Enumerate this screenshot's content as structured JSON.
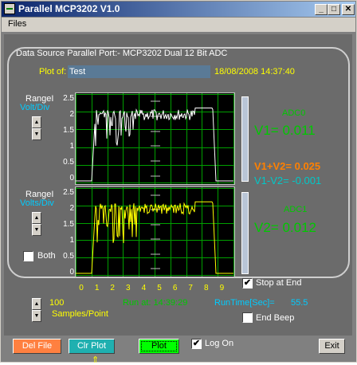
{
  "window": {
    "title": "Parallel MCP3202 V1.0",
    "minimize": "_",
    "maximize": "□",
    "close": "✕"
  },
  "menu": {
    "files": "Files"
  },
  "header": {
    "data_source": "Data Source Parallel Port:-   MCP3202 Dual 12 Bit ADC",
    "plot_of_label": "Plot of:",
    "plot_of_value": "Test",
    "datetime": "18/08/2008 14:37:40"
  },
  "range1": {
    "label": "RangeI",
    "sub": "Volt/Div"
  },
  "range2": {
    "label": "RangeI",
    "sub": "Volts/Div"
  },
  "both_label": "Both",
  "y_ticks": [
    "2.5",
    "2",
    "1.5",
    "1",
    "0.5",
    "0"
  ],
  "x_ticks": [
    "0",
    "1",
    "2",
    "3",
    "4",
    "5",
    "6",
    "7",
    "8",
    "9"
  ],
  "adc0": {
    "label": "ADC0",
    "value": "V1= 0.011"
  },
  "adc1": {
    "label": "ADC1",
    "value": "V2= 0.012"
  },
  "sum": "V1+V2= 0.025",
  "diff": "V1-V2=  -0.001",
  "stop_at_end": "Stop at End",
  "end_beep": "End Beep",
  "samples": {
    "value": "100",
    "label": "Samples/Point"
  },
  "run_at": "Run at: 14:39:29",
  "runtime": {
    "label": "RunTime[Sec]=",
    "value": "55.5"
  },
  "buttons": {
    "del_file": "Del File",
    "clr_plot": "Clr Plot",
    "plot": "Plot",
    "log_on": "Log On",
    "exit": "Exit"
  },
  "colors": {
    "adc": "#00c800",
    "sum": "#ff8000",
    "diff": "#00c8c8",
    "plot_of": "#ffff00",
    "trace1": "#ffffff",
    "trace2": "#ffff00",
    "grid": "#00a000"
  }
}
